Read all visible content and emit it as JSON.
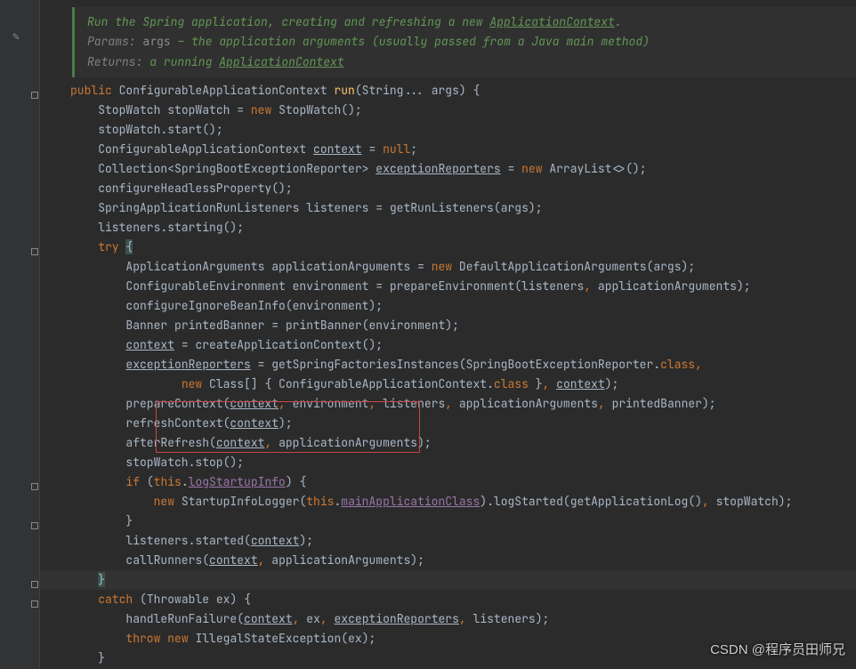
{
  "doc": {
    "line1_pre": "Run the Spring application, creating and refreshing a new ",
    "line1_link": "ApplicationContext",
    "line1_post": ".",
    "line2_label": "Params:",
    "line2_name": "args",
    "line2_rest": " – the application arguments (usually passed from a Java main method)",
    "line3_label": "Returns:",
    "line3_rest": " a running ",
    "line3_link": "ApplicationContext"
  },
  "code": {
    "l1": "public ConfigurableApplicationContext run(String... args) {",
    "l2": "    StopWatch stopWatch = new StopWatch();",
    "l3": "    stopWatch.start();",
    "l4": "    ConfigurableApplicationContext context = null;",
    "l5": "    Collection<SpringBootExceptionReporter> exceptionReporters = new ArrayList<>();",
    "l6": "    configureHeadlessProperty();",
    "l7": "    SpringApplicationRunListeners listeners = getRunListeners(args);",
    "l8": "    listeners.starting();",
    "l9": "    try {",
    "l10": "        ApplicationArguments applicationArguments = new DefaultApplicationArguments(args);",
    "l11": "        ConfigurableEnvironment environment = prepareEnvironment(listeners, applicationArguments);",
    "l12": "        configureIgnoreBeanInfo(environment);",
    "l13": "        Banner printedBanner = printBanner(environment);",
    "l14": "        context = createApplicationContext();",
    "l15": "        exceptionReporters = getSpringFactoriesInstances(SpringBootExceptionReporter.class,",
    "l16": "                new Class[] { ConfigurableApplicationContext.class }, context);",
    "l17": "        prepareContext(context, environment, listeners, applicationArguments, printedBanner);",
    "l18": "        refreshContext(context);",
    "l19": "        afterRefresh(context, applicationArguments);",
    "l20": "        stopWatch.stop();",
    "l21": "        if (this.logStartupInfo) {",
    "l22": "            new StartupInfoLogger(this.mainApplicationClass).logStarted(getApplicationLog(), stopWatch);",
    "l23": "        }",
    "l24": "        listeners.started(context);",
    "l25": "        callRunners(context, applicationArguments);",
    "l26": "    }",
    "l27": "    catch (Throwable ex) {",
    "l28": "        handleRunFailure(context, ex, exceptionReporters, listeners);",
    "l29": "        throw new IllegalStateException(ex);",
    "l30": "    }"
  },
  "watermark": "CSDN @程序员田师兄"
}
